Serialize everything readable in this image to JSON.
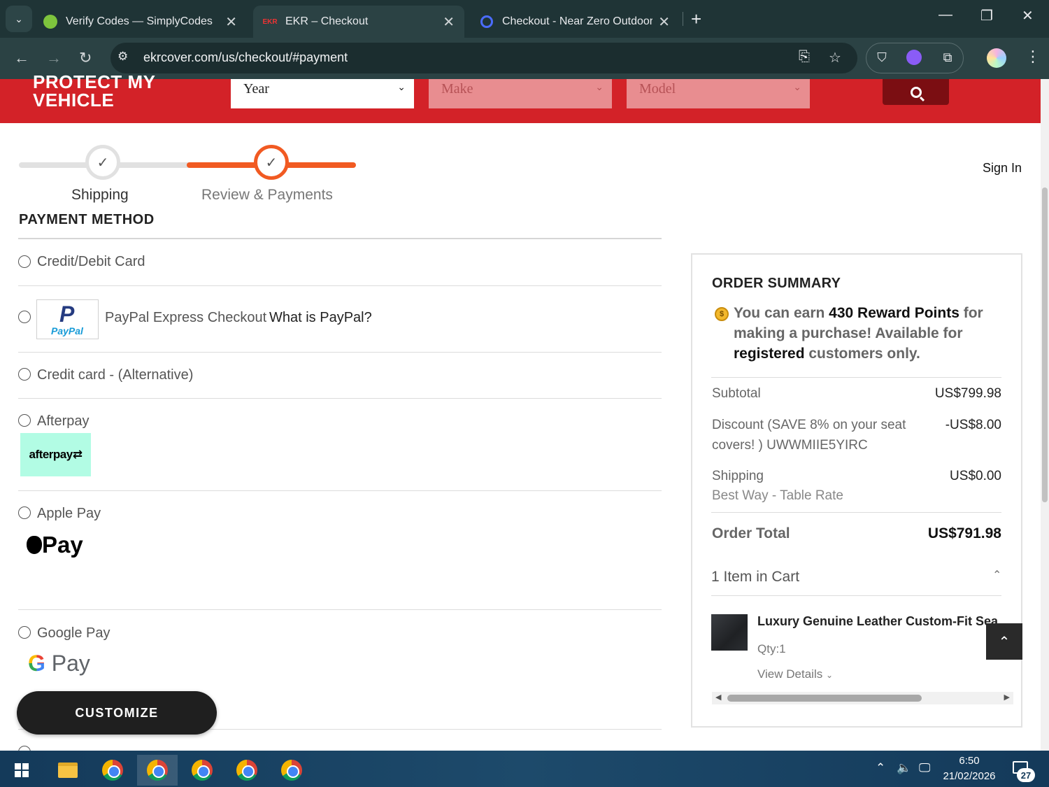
{
  "browser": {
    "tabs": [
      {
        "title": "Verify Codes — SimplyCodes",
        "close": "✕"
      },
      {
        "title": "EKR – Checkout",
        "favicon_text": "EKR",
        "close": "✕"
      },
      {
        "title": "Checkout - Near Zero Outdoor",
        "close": "✕"
      }
    ],
    "new_tab": "+",
    "url": "ekrcover.com/us/checkout/#payment"
  },
  "vehicle_bar": {
    "title": "PROTECT MY VEHICLE",
    "year_placeholder": "Year",
    "make_placeholder": "Make",
    "model_placeholder": "Model"
  },
  "progress": {
    "steps": [
      {
        "label": "Shipping"
      },
      {
        "label": "Review & Payments"
      }
    ],
    "active_step": 2
  },
  "account": {
    "sign_in": "Sign In"
  },
  "payment": {
    "title": "PAYMENT METHOD",
    "options": [
      {
        "label": "Credit/Debit Card"
      },
      {
        "label": "PayPal Express Checkout",
        "link": "What is PayPal?",
        "logo_p": "P",
        "logo_word": "PayPal"
      },
      {
        "label": "Credit card - (Alternative)"
      },
      {
        "label": "Afterpay",
        "badge": "afterpay⇄"
      },
      {
        "label": "Apple Pay",
        "mark": "Pay"
      },
      {
        "label": "Google Pay",
        "mark_g": "G",
        "mark": "Pay"
      }
    ],
    "customize_label": "CUSTOMIZE"
  },
  "summary": {
    "title": "ORDER SUMMARY",
    "coin": "$",
    "reward_pre": "You can earn ",
    "reward_points": "430 Reward Points",
    "reward_mid": " for making a purchase! Available for ",
    "reward_registered": "registered",
    "reward_post": " customers only.",
    "subtotal_label": "Subtotal",
    "subtotal_value": "US$799.98",
    "discount_label": "Discount (SAVE 8% on your seat covers! ) UWWMIIE5YIRC",
    "discount_value": "-US$8.00",
    "shipping_label": "Shipping",
    "shipping_method": "Best Way - Table Rate",
    "shipping_value": "US$0.00",
    "total_label": "Order Total",
    "total_value": "US$791.98",
    "cart_count": "1 Item in Cart",
    "item": {
      "name": "Luxury Genuine Leather Custom-Fit Sea",
      "qty": "Qty:1",
      "view_details": "View Details"
    }
  },
  "taskbar": {
    "time": "6:50",
    "date": "21/02/2026",
    "notifications": "27"
  }
}
